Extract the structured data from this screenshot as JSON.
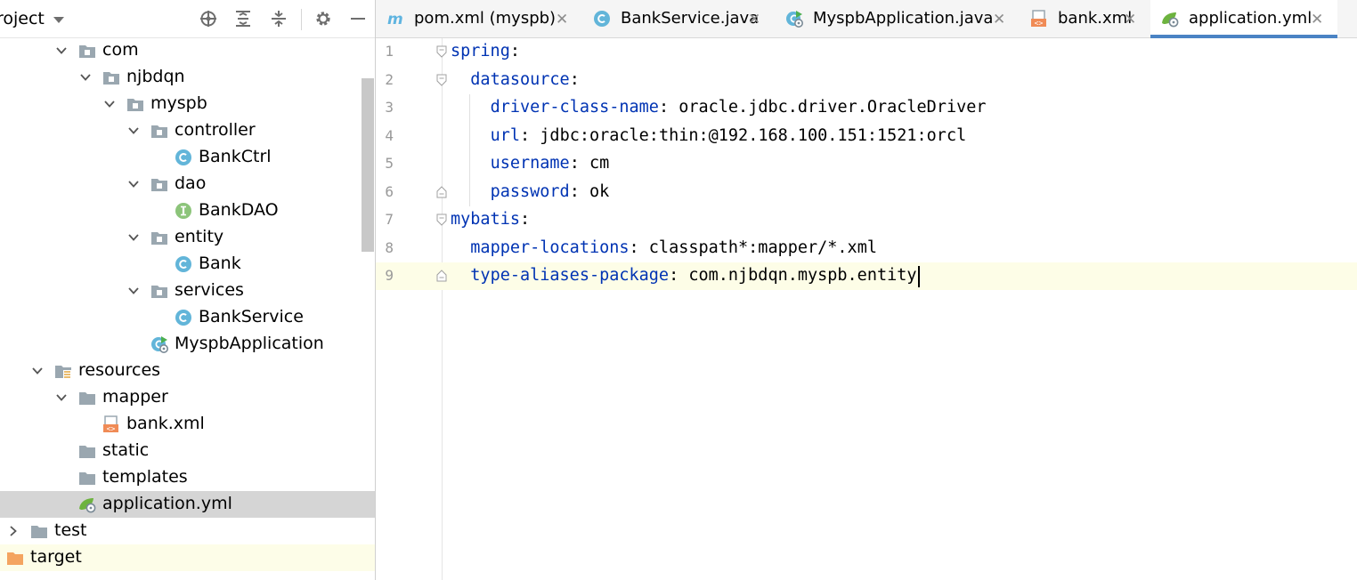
{
  "project_panel": {
    "title": "roject",
    "toolbar_icons": [
      "locate-icon",
      "expand-all-icon",
      "collapse-all-icon",
      "gear-icon",
      "minimize-icon"
    ],
    "tree": [
      {
        "label": "com",
        "type": "package",
        "expanded": true
      },
      {
        "label": "njbdqn",
        "type": "package",
        "expanded": true
      },
      {
        "label": "myspb",
        "type": "package",
        "expanded": true
      },
      {
        "label": "controller",
        "type": "package",
        "expanded": true
      },
      {
        "label": "BankCtrl",
        "type": "class"
      },
      {
        "label": "dao",
        "type": "package",
        "expanded": true
      },
      {
        "label": "BankDAO",
        "type": "interface"
      },
      {
        "label": "entity",
        "type": "package",
        "expanded": true
      },
      {
        "label": "Bank",
        "type": "class"
      },
      {
        "label": "services",
        "type": "package",
        "expanded": true
      },
      {
        "label": "BankService",
        "type": "class"
      },
      {
        "label": "MyspbApplication",
        "type": "spring-class"
      },
      {
        "label": "resources",
        "type": "resources-folder",
        "expanded": true
      },
      {
        "label": "mapper",
        "type": "folder",
        "expanded": true
      },
      {
        "label": "bank.xml",
        "type": "xml"
      },
      {
        "label": "static",
        "type": "folder"
      },
      {
        "label": "templates",
        "type": "folder"
      },
      {
        "label": "application.yml",
        "type": "yml",
        "selected": true
      },
      {
        "label": "test",
        "type": "folder",
        "expanded": false
      },
      {
        "label": "target",
        "type": "excluded-folder"
      }
    ]
  },
  "tabs": [
    {
      "label": "pom.xml (myspb)",
      "icon": "maven-icon"
    },
    {
      "label": "BankService.java",
      "icon": "class-icon"
    },
    {
      "label": "MyspbApplication.java",
      "icon": "spring-class-icon"
    },
    {
      "label": "bank.xml",
      "icon": "xml-icon"
    },
    {
      "label": "application.yml",
      "icon": "spring-yml-icon",
      "active": true
    }
  ],
  "tab_close_glyph": "✕",
  "editor": {
    "lines": [
      {
        "num": "1",
        "key": "spring",
        "sep": ":",
        "value": ""
      },
      {
        "num": "2",
        "key": "datasource",
        "sep": ":",
        "value": ""
      },
      {
        "num": "3",
        "key": "driver-class-name",
        "sep": ":",
        "value": " oracle.jdbc.driver.OracleDriver"
      },
      {
        "num": "4",
        "key": "url",
        "sep": ":",
        "value": " jdbc:oracle:thin:@192.168.100.151:1521:orcl"
      },
      {
        "num": "5",
        "key": "username",
        "sep": ":",
        "value": " cm"
      },
      {
        "num": "6",
        "key": "password",
        "sep": ":",
        "value": " ok"
      },
      {
        "num": "7",
        "key": "mybatis",
        "sep": ":",
        "value": ""
      },
      {
        "num": "8",
        "key": "mapper-locations",
        "sep": ":",
        "value": " classpath*:mapper/*.xml"
      },
      {
        "num": "9",
        "key": "type-aliases-package",
        "sep": ":",
        "value": " com.njbdqn.myspb.entity"
      }
    ],
    "current_line": 9
  },
  "colors": {
    "yaml_key": "#0033b3",
    "active_tab_underline": "#4a83c4",
    "selected_row": "#d5d5d5",
    "current_line_bg": "#fdfde7"
  }
}
